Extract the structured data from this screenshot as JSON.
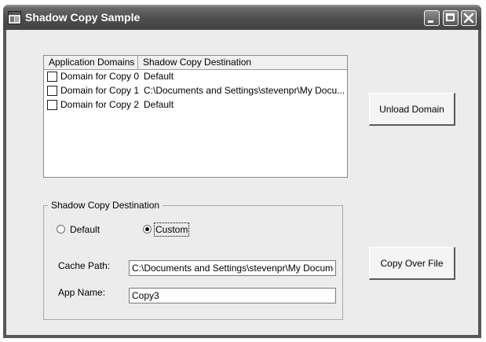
{
  "window": {
    "title": "Shadow Copy Sample"
  },
  "listview": {
    "columns": [
      "Application Domains",
      "Shadow Copy Destination"
    ],
    "rows": [
      {
        "name": "Domain for Copy 0",
        "destination": "Default",
        "checked": false
      },
      {
        "name": "Domain for Copy 1",
        "destination": "C:\\Documents and Settings\\stevenpr\\My Docu...",
        "checked": false
      },
      {
        "name": "Domain for Copy 2",
        "destination": "Default",
        "checked": false
      }
    ]
  },
  "buttons": {
    "unload": "Unload Domain",
    "copy_over": "Copy Over File"
  },
  "group": {
    "legend": "Shadow Copy Destination",
    "radio_default": "Default",
    "radio_custom": "Custom",
    "selected": "Custom",
    "cache_path_label": "Cache Path:",
    "cache_path_value": "C:\\Documents and Settings\\stevenpr\\My Docume",
    "app_name_label": "App Name:",
    "app_name_value": "Copy3"
  }
}
